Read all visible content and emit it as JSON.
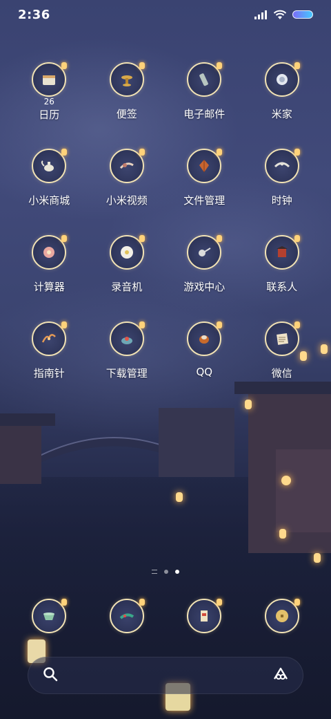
{
  "status_bar": {
    "time": "2:36",
    "icons": [
      "signal-icon",
      "wifi-icon",
      "battery-icon"
    ]
  },
  "apps": [
    {
      "label": "日历",
      "badge": "26",
      "icon": "calendar-icon"
    },
    {
      "label": "便签",
      "badge": "",
      "icon": "notes-icon"
    },
    {
      "label": "电子邮件",
      "badge": "",
      "icon": "email-icon"
    },
    {
      "label": "米家",
      "badge": "",
      "icon": "mihome-icon"
    },
    {
      "label": "小米商城",
      "badge": "",
      "icon": "store-icon"
    },
    {
      "label": "小米视频",
      "badge": "",
      "icon": "video-icon"
    },
    {
      "label": "文件管理",
      "badge": "",
      "icon": "files-icon"
    },
    {
      "label": "时钟",
      "badge": "",
      "icon": "clock-icon"
    },
    {
      "label": "计算器",
      "badge": "",
      "icon": "calculator-icon"
    },
    {
      "label": "录音机",
      "badge": "",
      "icon": "recorder-icon"
    },
    {
      "label": "游戏中心",
      "badge": "",
      "icon": "game-center-icon"
    },
    {
      "label": "联系人",
      "badge": "",
      "icon": "contacts-icon"
    },
    {
      "label": "指南针",
      "badge": "",
      "icon": "compass-icon"
    },
    {
      "label": "下载管理",
      "badge": "",
      "icon": "downloads-icon"
    },
    {
      "label": "QQ",
      "badge": "",
      "icon": "qq-icon"
    },
    {
      "label": "微信",
      "badge": "",
      "icon": "wechat-icon"
    }
  ],
  "page_indicator": {
    "pages": 2,
    "active": 2
  },
  "dock": [
    {
      "icon": "phone-icon"
    },
    {
      "icon": "messages-icon"
    },
    {
      "icon": "browser-icon"
    },
    {
      "icon": "camera-icon"
    }
  ],
  "search": {
    "icon": "search-icon",
    "assistant_icon": "assistant-icon"
  },
  "colors": {
    "icon_ring": "#f2e3b5",
    "lantern": "#ffd98c",
    "sky": "#3a4371"
  }
}
